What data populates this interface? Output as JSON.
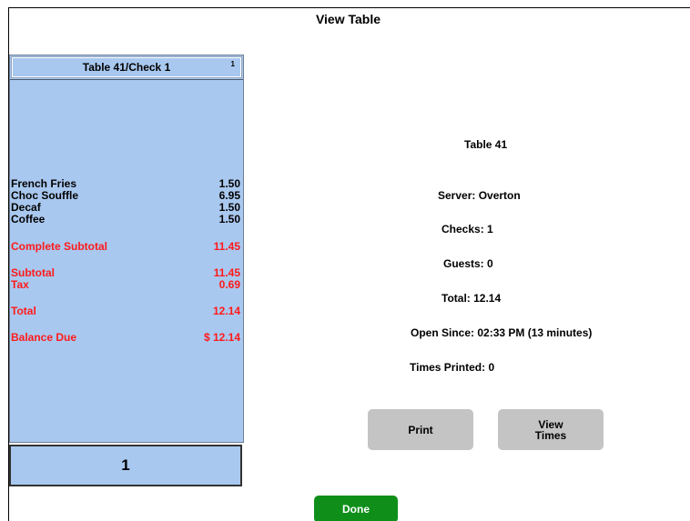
{
  "window": {
    "title": "View Table"
  },
  "check": {
    "header": "Table 41/Check 1",
    "number_badge": "1",
    "items": [
      {
        "name": "French Fries",
        "amount": "1.50"
      },
      {
        "name": "Choc Souffle",
        "amount": "6.95"
      },
      {
        "name": "Decaf",
        "amount": "1.50"
      },
      {
        "name": "Coffee",
        "amount": "1.50"
      }
    ],
    "complete_subtotal": {
      "label": "Complete Subtotal",
      "amount": "11.45"
    },
    "subtotal": {
      "label": "Subtotal",
      "amount": "11.45"
    },
    "tax": {
      "label": "Tax",
      "amount": "0.69"
    },
    "total": {
      "label": "Total",
      "amount": "12.14"
    },
    "balance_due": {
      "label": "Balance Due",
      "amount": "$ 12.14"
    },
    "seat": "1",
    "colors": {
      "panel": "#a9c8ef",
      "red_text": "#ff1a1a"
    }
  },
  "info": {
    "table": "Table 41",
    "server": "Server:  Overton",
    "checks": "Checks: 1",
    "guests": "Guests: 0",
    "total": "Total: 12.14",
    "open_since": "Open Since: 02:33 PM (13 minutes)",
    "times_printed": "Times Printed: 0"
  },
  "buttons": {
    "print": "Print",
    "view_times": "View\nTimes",
    "done": "Done"
  },
  "colors": {
    "done_button": "#0f8f1a",
    "gray_button": "#c4c4c4"
  }
}
